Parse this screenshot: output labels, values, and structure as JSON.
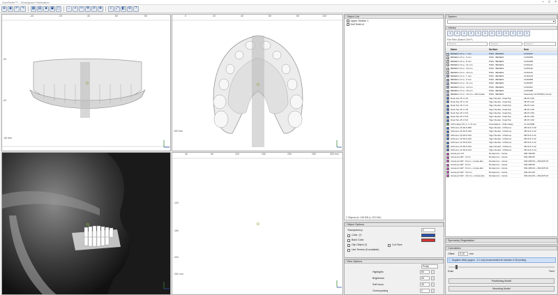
{
  "window": {
    "title": "SureSmile™ – Workspace Fabrication"
  },
  "toolbar_icons": [
    "open-icon",
    "save-icon",
    "undo-icon",
    "redo-icon",
    "layout-icon",
    "grid-icon",
    "view1-icon",
    "view2-icon",
    "view3-icon",
    "measure-icon",
    "select-icon",
    "cut-icon",
    "tool-icon",
    "rotate-icon",
    "pan-icon",
    "zoom-icon",
    "fit-icon",
    "snapshot-icon",
    "settings-icon",
    "help-icon"
  ],
  "views": {
    "front": {
      "ticks": [
        "-40",
        "20",
        "40",
        "60",
        "80"
      ],
      "left_tick": "-40",
      "mid_tick": "-20",
      "bottom_label": "-40 mm"
    },
    "top": {
      "ticks": [
        "0",
        "20",
        "40",
        "60",
        "80",
        "100"
      ],
      "right_label": "100 mm",
      "left_tick": "60"
    },
    "bottom_ticks": {
      "xs": [
        "40",
        "60",
        "100",
        "150",
        "200",
        "250",
        "300 mm"
      ],
      "ys": [
        "-100",
        "-150",
        "-200",
        "-250 mm"
      ]
    },
    "axis_label": "X"
  },
  "object_list": {
    "title": "Object List",
    "items": [
      "Upper Section 1",
      "Dull Solid of"
    ],
    "status": "2 Objects (in 138 305 (x 220 340)"
  },
  "object_options": {
    "title": "Object Options",
    "transparency_label": "Transparency",
    "transparency_value": "0",
    "color_label": "Color: (*)",
    "back_color_label": "Back Color",
    "clip_object_label": "Clip Object (*)",
    "cut_face_label": "Cut Face",
    "live_texture_label": "Use Texture (if available)",
    "color_value": "#2a4fae",
    "back_color_value": "#d63030"
  },
  "view_options": {
    "title": "View Options",
    "preset_value": "Prolly",
    "rows": [
      {
        "label": "Highlights",
        "value": "60"
      },
      {
        "label": "Brightness",
        "value": "60"
      },
      {
        "label": "Soft focus",
        "value": "30"
      },
      {
        "label": "Overexposing",
        "value": "0"
      }
    ]
  },
  "system": {
    "title": "System"
  },
  "library": {
    "title": "Library",
    "search_label": "Part Filter (Search Ctrl+F)",
    "search_placeholder_1": "Search...",
    "search_placeholder_2": "Search...",
    "search_placeholder_3": "Search...",
    "headers": [
      "Name",
      "Surface",
      "Item"
    ],
    "rows": [
      {
        "name": "BENEFit 2.0 a : 7 mm",
        "surface": "PSM - BENEFit",
        "item": "10-5h267",
        "color": "#d8d8d8",
        "sel": true
      },
      {
        "name": "BENEFit 2.0 a : 9 mm",
        "surface": "PSM - BENEFit",
        "item": "10-5h269",
        "color": "#d8d8d8"
      },
      {
        "name": "BENEFit 2.0 a : 8 mm",
        "surface": "PSM - BENEFit",
        "item": "10-5h268",
        "color": "#d8d8d8"
      },
      {
        "name": "BENEFit 2.0 a : 11 mm",
        "surface": "PSM - BENEFit",
        "item": "10-5h11b",
        "color": "#d8d8d8"
      },
      {
        "name": "BENEFit 2.0 a : 13 mm",
        "surface": "PSM - BENEFit",
        "item": "10-5h13b",
        "color": "#d8d8d8"
      },
      {
        "name": "BENEFit 2.0 a : 15 mm",
        "surface": "PSM - BENEFit",
        "item": "10-5h115",
        "color": "#d8d8d8"
      },
      {
        "name": "BENEFit 2.3 a : 7 mm",
        "surface": "PSM - BENEFit",
        "item": "10-5h123",
        "color": "#8ea3e0"
      },
      {
        "name": "BENEFit 2.3 a : 9 mm",
        "surface": "PSM - BENEFit",
        "item": "10-5h069",
        "color": "#8ea3e0"
      },
      {
        "name": "BENEFit 2.3 a : 11 mm",
        "surface": "PSM - BENEFit",
        "item": "10-5h087",
        "color": "#8ea3e0"
      },
      {
        "name": "BENEFit 2.3 a : 13 mm",
        "surface": "PSM - BENEFit",
        "item": "10-5h011",
        "color": "#8ea3e0"
      },
      {
        "name": "BENEFit 2.3 a : 15 mm",
        "surface": "PSM - BENEFit",
        "item": "10-5h058",
        "color": "#8ea3e0"
      },
      {
        "name": "BENEFit 2.3 a : 13 mm + Dbl Guide",
        "surface": "PSM - BENEFit",
        "item": "Scanbody 10-5h78(C) Group",
        "color": "#8ea3e0"
      },
      {
        "name": "Dual-Top 15 .0 4.0",
        "surface": "Tiger Dental - Dual-Top",
        "item": "2B 15 3.40",
        "color": "#2f6fd6"
      },
      {
        "name": "Dual-Top 15 .0 4.0",
        "surface": "Tiger Dental - Dual-Top",
        "item": "2B 15 3.42",
        "color": "#2f6fd6"
      },
      {
        "name": "Dual-Top 15 .0 4.4",
        "surface": "Tiger Dental - Dual-Top",
        "item": "2B 15 3.44",
        "color": "#2f6fd6"
      },
      {
        "name": "Dual-Top 15 .0 4.8",
        "surface": "Tiger Dental - Dual-Top",
        "item": "2B 15 3.46",
        "color": "#2f6fd6"
      },
      {
        "name": "Dual-Top 15 .0 5.0",
        "surface": "Tiger Dental - Dual-Top",
        "item": "2B 15 3.50",
        "color": "#2f6fd6"
      },
      {
        "name": "Dual-Top 15 .0 5.5",
        "surface": "Tiger Dental - Dual-Top",
        "item": "2B 15 3.55",
        "color": "#2f6fd6"
      },
      {
        "name": "Dual-Top 15 .0 6.0",
        "surface": "Tiger Dental - Dual-Top",
        "item": "2B 15 3.60",
        "color": "#2f6fd6"
      },
      {
        "name": "Ortho Easy Pin 1.7 x 8 mm",
        "surface": "Forestadent - Ortho Easy",
        "item": "12-1A2308",
        "color": "#3aa15a"
      },
      {
        "name": "OrthoLox 10 DLS 060",
        "surface": "Tiger Dental - OrthoLox",
        "item": "2B OLS 3.10",
        "color": "#2f6fd6"
      },
      {
        "name": "OrthoLox 10 DLS 010",
        "surface": "Tiger Dental - OrthoLox",
        "item": "2B OLS 3.12",
        "color": "#2f6fd6"
      },
      {
        "name": "OrthoLox 10 DLS 012",
        "surface": "Tiger Dental - OrthoLox",
        "item": "2B OLS 3.12",
        "color": "#2f6fd6"
      },
      {
        "name": "OrthoLox 10 DLS 012",
        "surface": "Tiger Dental - OrthoLox",
        "item": "2B OLS 3.12",
        "color": "#2f6fd6"
      },
      {
        "name": "OrthoLox 11 DLS 012",
        "surface": "Tiger Dental - OrthoLox",
        "item": "2B OLS 3.12",
        "color": "#2f6fd6"
      },
      {
        "name": "OrthoLox 12 DLS 012",
        "surface": "Tiger Dental - OrthoLox",
        "item": "2B OLS 3.12",
        "color": "#2f6fd6"
      },
      {
        "name": "OrthoLox 12 DLS 014",
        "surface": "Tiger Dental - OrthoLox",
        "item": "2B OLS 3.14",
        "color": "#2f6fd6"
      },
      {
        "name": "tomas-pin 4-8",
        "surface": "Dentaurum - tomas",
        "item": "302-100-80",
        "color": "#d63cc8"
      },
      {
        "name": "tomas-pin EP : 6 mm",
        "surface": "Dentaurum - tomas",
        "item": "302-206-00",
        "color": "#d63cc8"
      },
      {
        "name": "tomas-pin EP : 8 mm + tomas-abu",
        "surface": "Dentaurum - tomas",
        "item": "302-208-00 + 302-625-01",
        "color": "#d63cc8"
      },
      {
        "name": "tomas-pin EP : 8 mm",
        "surface": "Dentaurum - tomas",
        "item": "302-208-00",
        "color": "#d63cc8"
      },
      {
        "name": "tomas-pin EP : 8 mm + tomas-abu",
        "surface": "Dentaurum - tomas",
        "item": "302-208-00 + 302-625-01",
        "color": "#d63cc8"
      },
      {
        "name": "tomas-pin EP : 10 mm",
        "surface": "Dentaurum - tomas",
        "item": "302-210-00",
        "color": "#d63cc8"
      },
      {
        "name": "tomas-pin EP : 10 mm + tomas-abu",
        "surface": "Dentaurum - tomas",
        "item": "302-210-00 + 302-625-01",
        "color": "#d63cc8"
      }
    ]
  },
  "symmetry": {
    "title": "Symmetry Registration"
  },
  "calculation": {
    "title": "Calculation",
    "offset_label": "Offset",
    "offset_value": "0.15",
    "offset_unit": "mm",
    "info_text": "Negative offset (approx. -0.1 mm) recommended for insertion in 3D printing.",
    "slider_min": "Exact",
    "slider_max": "Fixed",
    "button1": "Positioning Model",
    "button2": "Mounting Model"
  }
}
